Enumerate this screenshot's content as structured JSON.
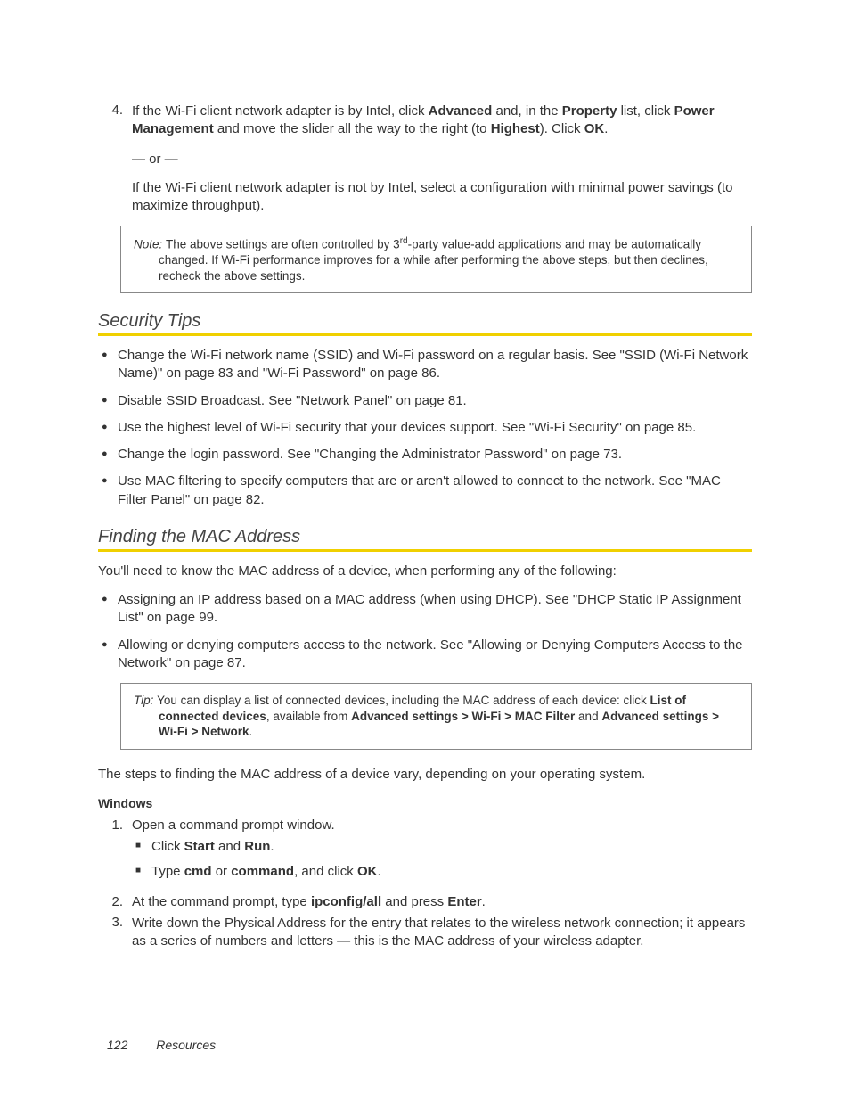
{
  "step4": {
    "num": "4.",
    "part1a": "If the Wi-Fi client network adapter is by Intel, click ",
    "b1": "Advanced",
    "part1b": " and, in the ",
    "b2": "Property",
    "part1c": " list, click ",
    "b3": "Power Management",
    "part1d": " and move the slider all the way to the right (to ",
    "b4": "Highest",
    "part1e": "). Click ",
    "b5": "OK",
    "part1f": ".",
    "or": "— or —",
    "part2": "If the Wi-Fi client network adapter is not by Intel, select a configuration with minimal power savings (to maximize throughput)."
  },
  "noteBox": {
    "label": "Note:  ",
    "t1": "The above settings are often controlled by 3",
    "sup": "rd",
    "t2": "-party value-add applications and may be automatically changed. If Wi-Fi performance improves for a while after performing the above steps, but then declines, recheck the above settings."
  },
  "sec1": {
    "heading": "Security Tips",
    "b1": "Change the Wi-Fi network name (SSID) and Wi-Fi password on a regular basis. See \"SSID (Wi-Fi Network Name)\" on page 83 and \"Wi-Fi Password\" on page 86.",
    "b2": "Disable SSID Broadcast. See \"Network Panel\" on page 81.",
    "b3": "Use the highest level of Wi-Fi security that your devices support. See \"Wi-Fi Security\" on page 85.",
    "b4": "Change the login password. See \"Changing the Administrator Password\" on page 73.",
    "b5": "Use MAC filtering to specify computers that are or aren't allowed to connect to the network. See \"MAC Filter Panel\" on page 82."
  },
  "sec2": {
    "heading": "Finding the MAC Address",
    "intro": "You'll need to know the MAC address of a device, when performing any of the following:",
    "b1": "Assigning an IP address based on a MAC address (when using DHCP). See \"DHCP Static IP Assignment List\" on page 99.",
    "b2": "Allowing or denying computers access to the network. See \"Allowing or Denying Computers Access to the Network\" on page 87."
  },
  "tipBox": {
    "label": "Tip: ",
    "t1": "You can display a list of connected devices, including the MAC address of each device: click ",
    "b1": "List of connected devices",
    "t2": ", available from ",
    "b2": "Advanced settings",
    "gt1": " > ",
    "b3": "Wi-Fi",
    "gt2": " > ",
    "b4": "MAC Filter",
    "t3": " and ",
    "b5": "Advanced settings",
    "gt3": " > ",
    "b6": "Wi-Fi",
    "gt4": " > ",
    "b7": "Network",
    "t4": "."
  },
  "afterTip": "The steps to finding the MAC address of a device vary, depending on your operating system.",
  "winHead": "Windows",
  "winSteps": {
    "s1num": "1.",
    "s1text": "Open a command prompt window.",
    "s1sub1a": "Click ",
    "s1sub1b1": "Start",
    "s1sub1c": " and ",
    "s1sub1b2": "Run",
    "s1sub1d": ".",
    "s1sub2a": "Type ",
    "s1sub2b1": "cmd",
    "s1sub2c": " or ",
    "s1sub2b2": "command",
    "s1sub2d": ", and click ",
    "s1sub2b3": "OK",
    "s1sub2e": ".",
    "s2num": "2.",
    "s2a": "At the command prompt, type ",
    "s2b": "ipconfig/all",
    "s2c": " and press ",
    "s2d": "Enter",
    "s2e": ".",
    "s3num": "3.",
    "s3": "Write down the Physical Address for the entry that relates to the wireless network connection; it appears as a series of numbers and letters — this is the MAC address of your wireless adapter."
  },
  "footer": {
    "page": "122",
    "section": "Resources"
  }
}
